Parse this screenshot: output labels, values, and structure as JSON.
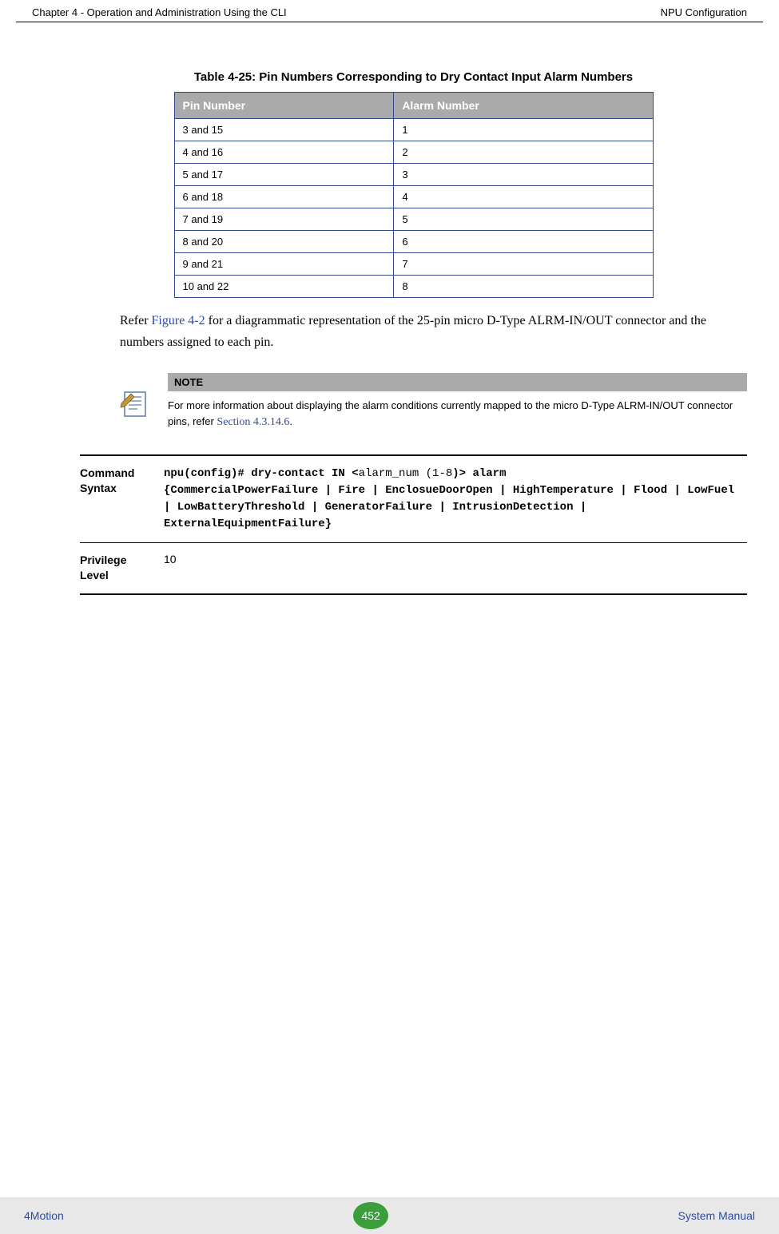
{
  "header": {
    "left": "Chapter 4 - Operation and Administration Using the CLI",
    "right": "NPU Configuration"
  },
  "table": {
    "title": "Table 4-25: Pin Numbers Corresponding to Dry Contact Input Alarm Numbers",
    "col1": "Pin Number",
    "col2": "Alarm Number",
    "rows": [
      {
        "pin": "3 and 15",
        "alarm": "1"
      },
      {
        "pin": "4 and 16",
        "alarm": "2"
      },
      {
        "pin": "5 and 17",
        "alarm": "3"
      },
      {
        "pin": "6 and 18",
        "alarm": "4"
      },
      {
        "pin": "7 and 19",
        "alarm": "5"
      },
      {
        "pin": "8 and 20",
        "alarm": "6"
      },
      {
        "pin": "9 and 21",
        "alarm": "7"
      },
      {
        "pin": "10 and 22",
        "alarm": "8"
      }
    ]
  },
  "paragraph": {
    "pre": "Refer ",
    "link": "Figure 4-2",
    "post": " for a diagrammatic representation of the 25-pin micro D-Type ALRM-IN/OUT connector and the numbers assigned to each pin."
  },
  "note": {
    "header": "NOTE",
    "text_pre": "For more information about displaying the alarm conditions currently mapped to the micro D-Type ALRM-IN/OUT connector pins, refer ",
    "ref": "Section 4.3.14.6",
    "text_post": "."
  },
  "command": {
    "label": "Command Syntax",
    "line1_bold1": "npu(config)# dry-contact IN <",
    "line1_plain": "alarm_num (1-8",
    "line1_bold2": ")> alarm",
    "body": "{CommercialPowerFailure | Fire | EnclosueDoorOpen | HighTemperature | Flood | LowFuel | LowBatteryThreshold | GeneratorFailure | IntrusionDetection | ExternalEquipmentFailure}"
  },
  "privilege": {
    "label": "Privilege Level",
    "value": "10"
  },
  "footer": {
    "left": "4Motion",
    "page": "452",
    "right": "System Manual"
  }
}
